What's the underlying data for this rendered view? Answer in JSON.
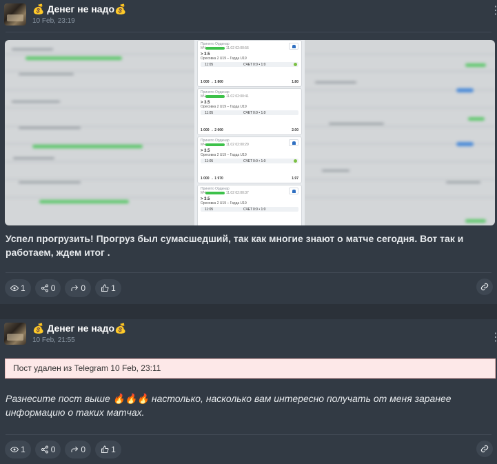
{
  "posts": [
    {
      "channel": "💰 Денег не надо💰",
      "date": "10 Feb, 23:19",
      "text": "Успел прогрузить! Прогруз был сумасшедший, так как многие знают о матче сегодня. Вот так и работаем, ждем итог .",
      "views": "1",
      "shares": "0",
      "forwards": "0",
      "likes": "1",
      "screenshot": {
        "bets": [
          {
            "status": "Принято",
            "type": "Ординар",
            "id_prefix": "МЧ",
            "time_stamp": "11.02 02:00:56",
            "market": "> 3.5",
            "match": "Ореховка 2 U19 – Гарда U19",
            "time": "11:05",
            "score_label": "СЧЕТ",
            "score": "0:0 • 1:0",
            "amount": "1 000",
            "payout": "1 800",
            "coef": "1.80"
          },
          {
            "status": "Принято",
            "type": "Ординар",
            "id_prefix": "МЧ",
            "time_stamp": "11.02 02:00:41",
            "market": "> 3.5",
            "match": "Ореховка 2 U19 – Гарда U19",
            "time": "11:05",
            "score_label": "СЧЕТ",
            "score": "0:0 • 1:0",
            "amount": "1 000",
            "payout": "2 000",
            "coef": "2.00"
          },
          {
            "status": "Принято",
            "type": "Ординар",
            "id_prefix": "МЧ",
            "time_stamp": "11.02 02:00:29",
            "market": "> 3.5",
            "match": "Ореховка 2 U19 – Гарда U19",
            "time": "11:05",
            "score_label": "СЧЕТ",
            "score": "0:0 • 1:0",
            "amount": "1 000",
            "payout": "1 970",
            "coef": "1.97"
          },
          {
            "status": "Принято",
            "type": "Ординар",
            "id_prefix": "МЧ",
            "time_stamp": "11.02 02:00:37",
            "market": "> 3.5",
            "match": "Ореховка 2 U19 – Гарда U19",
            "time": "11:05",
            "score_label": "СЧЕТ",
            "score": "0:0 • 1:0",
            "amount": "",
            "payout": "",
            "coef": ""
          }
        ]
      }
    },
    {
      "channel": "💰 Денег не надо💰",
      "date": "10 Feb, 21:55",
      "deleted_notice": "Пост удален из Telegram",
      "deleted_date": "10 Feb, 23:11",
      "text": "Разнесите пост выше 🔥🔥🔥 настолько, насколько вам интересно получать от меня заранее информацию о таких матчах.",
      "views": "1",
      "shares": "0",
      "forwards": "0",
      "likes": "1"
    }
  ],
  "colors": {
    "page_bg": "#2b3139",
    "card_bg": "#323a44",
    "pill_bg": "#3e4752",
    "deleted_bg": "#fde8e8"
  }
}
